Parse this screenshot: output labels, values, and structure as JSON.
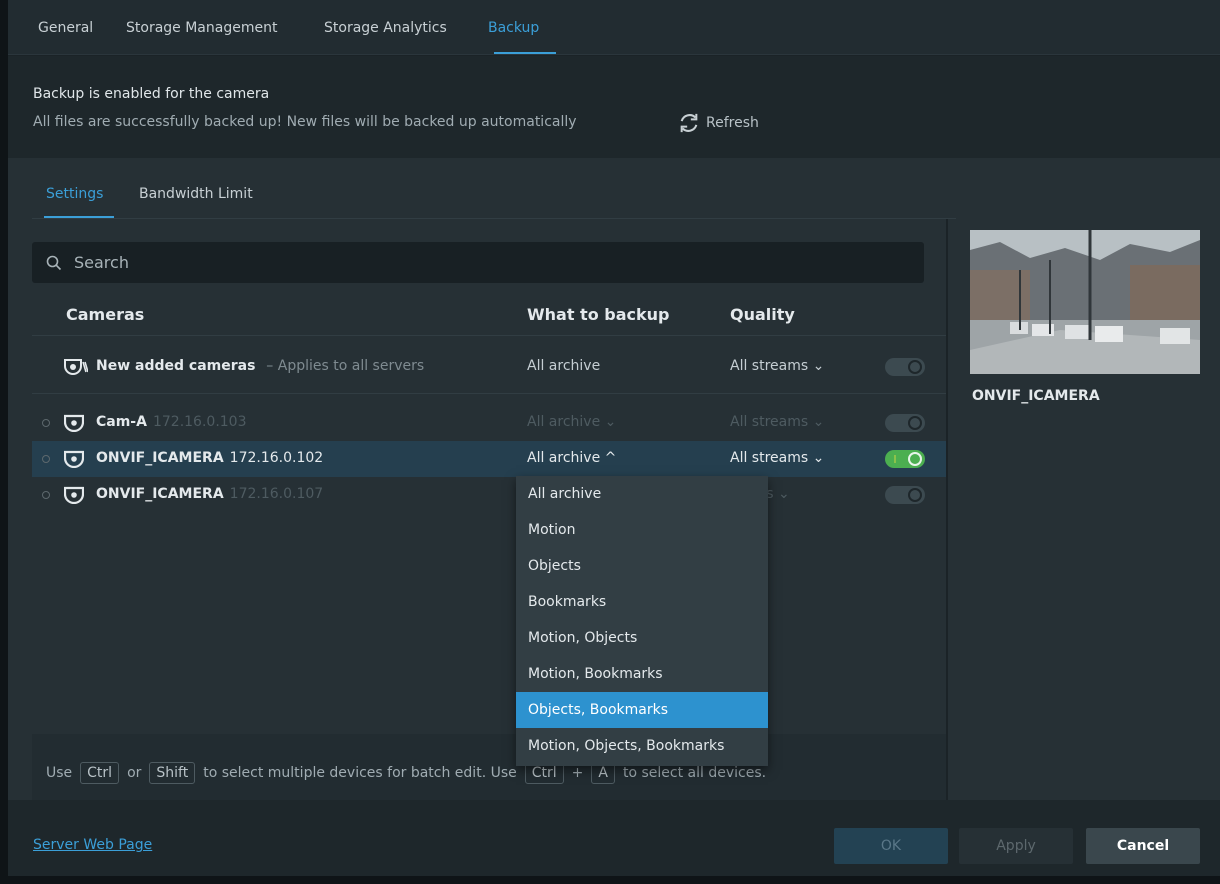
{
  "top_tabs": [
    "General",
    "Storage Management",
    "Storage Analytics",
    "Backup"
  ],
  "status": {
    "title": "Backup is enabled for the camera",
    "subtitle": "All files are successfully backed up! New files will be backed up automatically",
    "refresh_label": "Refresh"
  },
  "sub_tabs": [
    "Settings",
    "Bandwidth Limit"
  ],
  "search": {
    "placeholder": "Search"
  },
  "columns": {
    "cameras": "Cameras",
    "what": "What to backup",
    "quality": "Quality"
  },
  "new_cameras": {
    "name": "New added cameras",
    "note": "– Applies to all servers",
    "what": "All archive",
    "quality": "All streams ⌄",
    "enabled": false
  },
  "cameras": [
    {
      "name": "Cam-A",
      "ip": "172.16.0.103",
      "what": "All archive ⌄",
      "quality": "All streams ⌄",
      "enabled": false
    },
    {
      "name": "ONVIF_ICAMERA",
      "ip": "172.16.0.102",
      "what": "All archive ^",
      "quality": "All streams ⌄",
      "enabled": true
    },
    {
      "name": "ONVIF_ICAMERA",
      "ip": "172.16.0.107",
      "what": "",
      "quality": "reams ⌄",
      "enabled": false
    }
  ],
  "dropdown_options": [
    "All archive",
    "Motion",
    "Objects",
    "Bookmarks",
    "Motion, Objects",
    "Motion, Bookmarks",
    "Objects, Bookmarks",
    "Motion, Objects, Bookmarks"
  ],
  "dropdown_selected": "Objects, Bookmarks",
  "hint": {
    "use": "Use",
    "ctrl": "Ctrl",
    "or": "or",
    "shift": "Shift",
    "text1": "to select multiple devices for batch edit. Use",
    "plus": "+",
    "a": "A",
    "text2": "to select all devices."
  },
  "preview": {
    "camera_name": "ONVIF_ICAMERA"
  },
  "footer": {
    "link": "Server Web Page",
    "ok": "OK",
    "apply": "Apply",
    "cancel": "Cancel"
  },
  "colors": {
    "accent": "#3b9fd8",
    "toggle_on": "#4caf50",
    "selected_row": "#253f4f"
  }
}
